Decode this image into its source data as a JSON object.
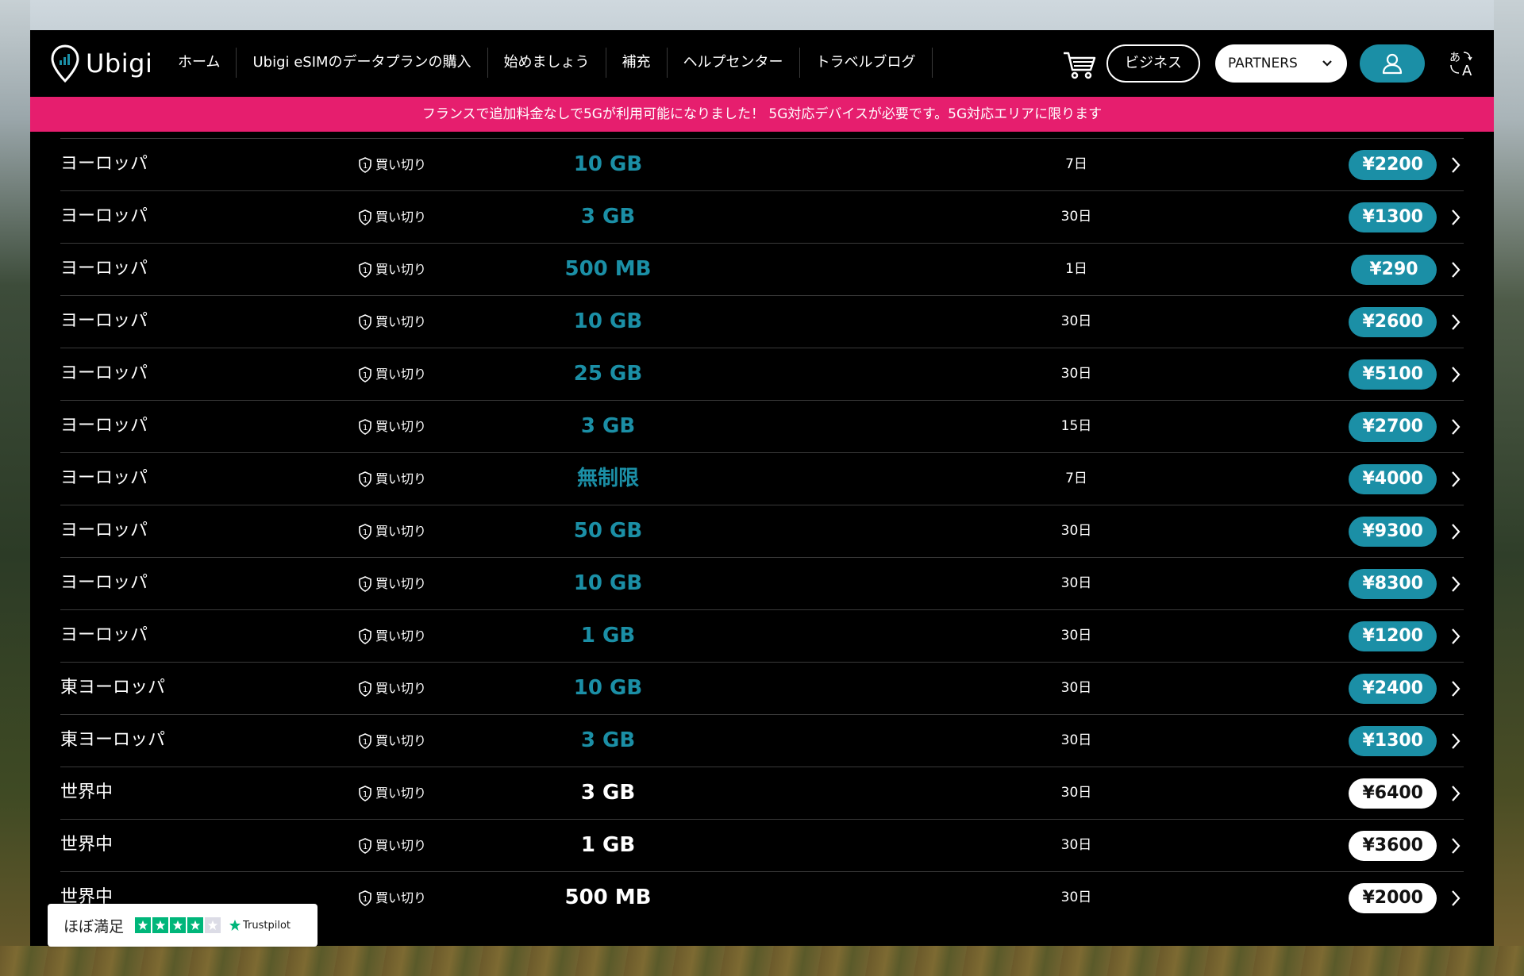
{
  "brand": {
    "name": "Ubigi",
    "accent": "#1b8fa6",
    "banner_color": "#e61e6e"
  },
  "nav": [
    {
      "label": "ホーム"
    },
    {
      "label": "Ubigi eSIMのデータプランの購入"
    },
    {
      "label": "始めましょう"
    },
    {
      "label": "補充"
    },
    {
      "label": "ヘルプセンター"
    },
    {
      "label": "トラベルブログ"
    }
  ],
  "header": {
    "cart_icon": "cart-icon",
    "business_label": "ビジネス",
    "partners_label": "PARTNERS",
    "account_icon": "user-icon",
    "language_icon": "translate-icon"
  },
  "banner": {
    "text": "フランスで追加料金なしで5Gが利用可能になりました！ 5G対応デバイスが必要です。5G対応エリアに限ります"
  },
  "plans": [
    {
      "region": "ヨーロッパ",
      "type": "買い切り",
      "data": "10 GB",
      "days": "7日",
      "price": "¥2200",
      "style": "teal"
    },
    {
      "region": "ヨーロッパ",
      "type": "買い切り",
      "data": "3 GB",
      "days": "30日",
      "price": "¥1300",
      "style": "teal"
    },
    {
      "region": "ヨーロッパ",
      "type": "買い切り",
      "data": "500 MB",
      "days": "1日",
      "price": "¥290",
      "style": "teal"
    },
    {
      "region": "ヨーロッパ",
      "type": "買い切り",
      "data": "10 GB",
      "days": "30日",
      "price": "¥2600",
      "style": "teal"
    },
    {
      "region": "ヨーロッパ",
      "type": "買い切り",
      "data": "25 GB",
      "days": "30日",
      "price": "¥5100",
      "style": "teal"
    },
    {
      "region": "ヨーロッパ",
      "type": "買い切り",
      "data": "3 GB",
      "days": "15日",
      "price": "¥2700",
      "style": "teal"
    },
    {
      "region": "ヨーロッパ",
      "type": "買い切り",
      "data": "無制限",
      "days": "7日",
      "price": "¥4000",
      "style": "teal"
    },
    {
      "region": "ヨーロッパ",
      "type": "買い切り",
      "data": "50 GB",
      "days": "30日",
      "price": "¥9300",
      "style": "teal"
    },
    {
      "region": "ヨーロッパ",
      "type": "買い切り",
      "data": "10 GB",
      "days": "30日",
      "price": "¥8300",
      "style": "teal"
    },
    {
      "region": "ヨーロッパ",
      "type": "買い切り",
      "data": "1 GB",
      "days": "30日",
      "price": "¥1200",
      "style": "teal"
    },
    {
      "region": "東ヨーロッパ",
      "type": "買い切り",
      "data": "10 GB",
      "days": "30日",
      "price": "¥2400",
      "style": "teal"
    },
    {
      "region": "東ヨーロッパ",
      "type": "買い切り",
      "data": "3 GB",
      "days": "30日",
      "price": "¥1300",
      "style": "teal"
    },
    {
      "region": "世界中",
      "type": "買い切り",
      "data": "3 GB",
      "days": "30日",
      "price": "¥6400",
      "style": "white"
    },
    {
      "region": "世界中",
      "type": "買い切り",
      "data": "1 GB",
      "days": "30日",
      "price": "¥3600",
      "style": "white"
    },
    {
      "region": "世界中",
      "type": "買い切り",
      "data": "500 MB",
      "days": "30日",
      "price": "¥2000",
      "style": "white"
    }
  ],
  "trustpilot": {
    "text": "ほぼ満足",
    "brand": "Trustpilot",
    "rating_stars": 4,
    "max_stars": 5
  }
}
